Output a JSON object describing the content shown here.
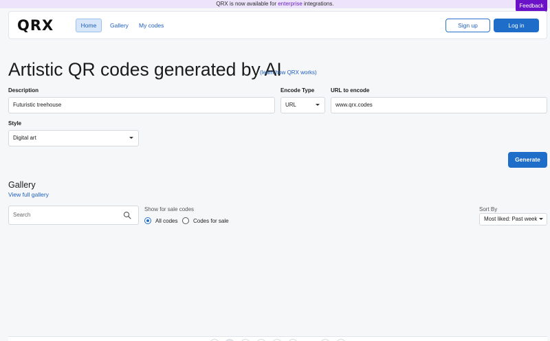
{
  "announcement": {
    "prefix": "QRX is now available for ",
    "link": "enterprise",
    "suffix": " integrations."
  },
  "feedback_label": "Feedback",
  "header": {
    "logo": "QRX",
    "nav": [
      {
        "label": "Home"
      },
      {
        "label": "Gallery"
      },
      {
        "label": "My codes"
      }
    ],
    "signup_label": "Sign up",
    "login_label": "Log in"
  },
  "hero": {
    "title": "Artistic QR codes generated by AI",
    "learn_link": "(learn how QRX works)"
  },
  "form": {
    "description_label": "Description",
    "description_value": "Futuristic treehouse",
    "encode_type_label": "Encode Type",
    "encode_type_value": "URL",
    "url_label": "URL to encode",
    "url_value": "www.qrx.codes",
    "style_label": "Style",
    "style_value": "Digital art",
    "generate_label": "Generate"
  },
  "gallery": {
    "heading": "Gallery",
    "view_full_link": "View full gallery",
    "search_placeholder": "Search",
    "show_for_sale_label": "Show for sale codes",
    "filter_options": [
      {
        "label": "All codes",
        "selected": true
      },
      {
        "label": "Codes for sale",
        "selected": false
      }
    ],
    "sort_label": "Sort By",
    "sort_value": "Most liked: Past week"
  },
  "colors": {
    "accent": "#1d6dc9",
    "feedback": "#6b12c9",
    "announcement_bg": "#ede4fb"
  }
}
